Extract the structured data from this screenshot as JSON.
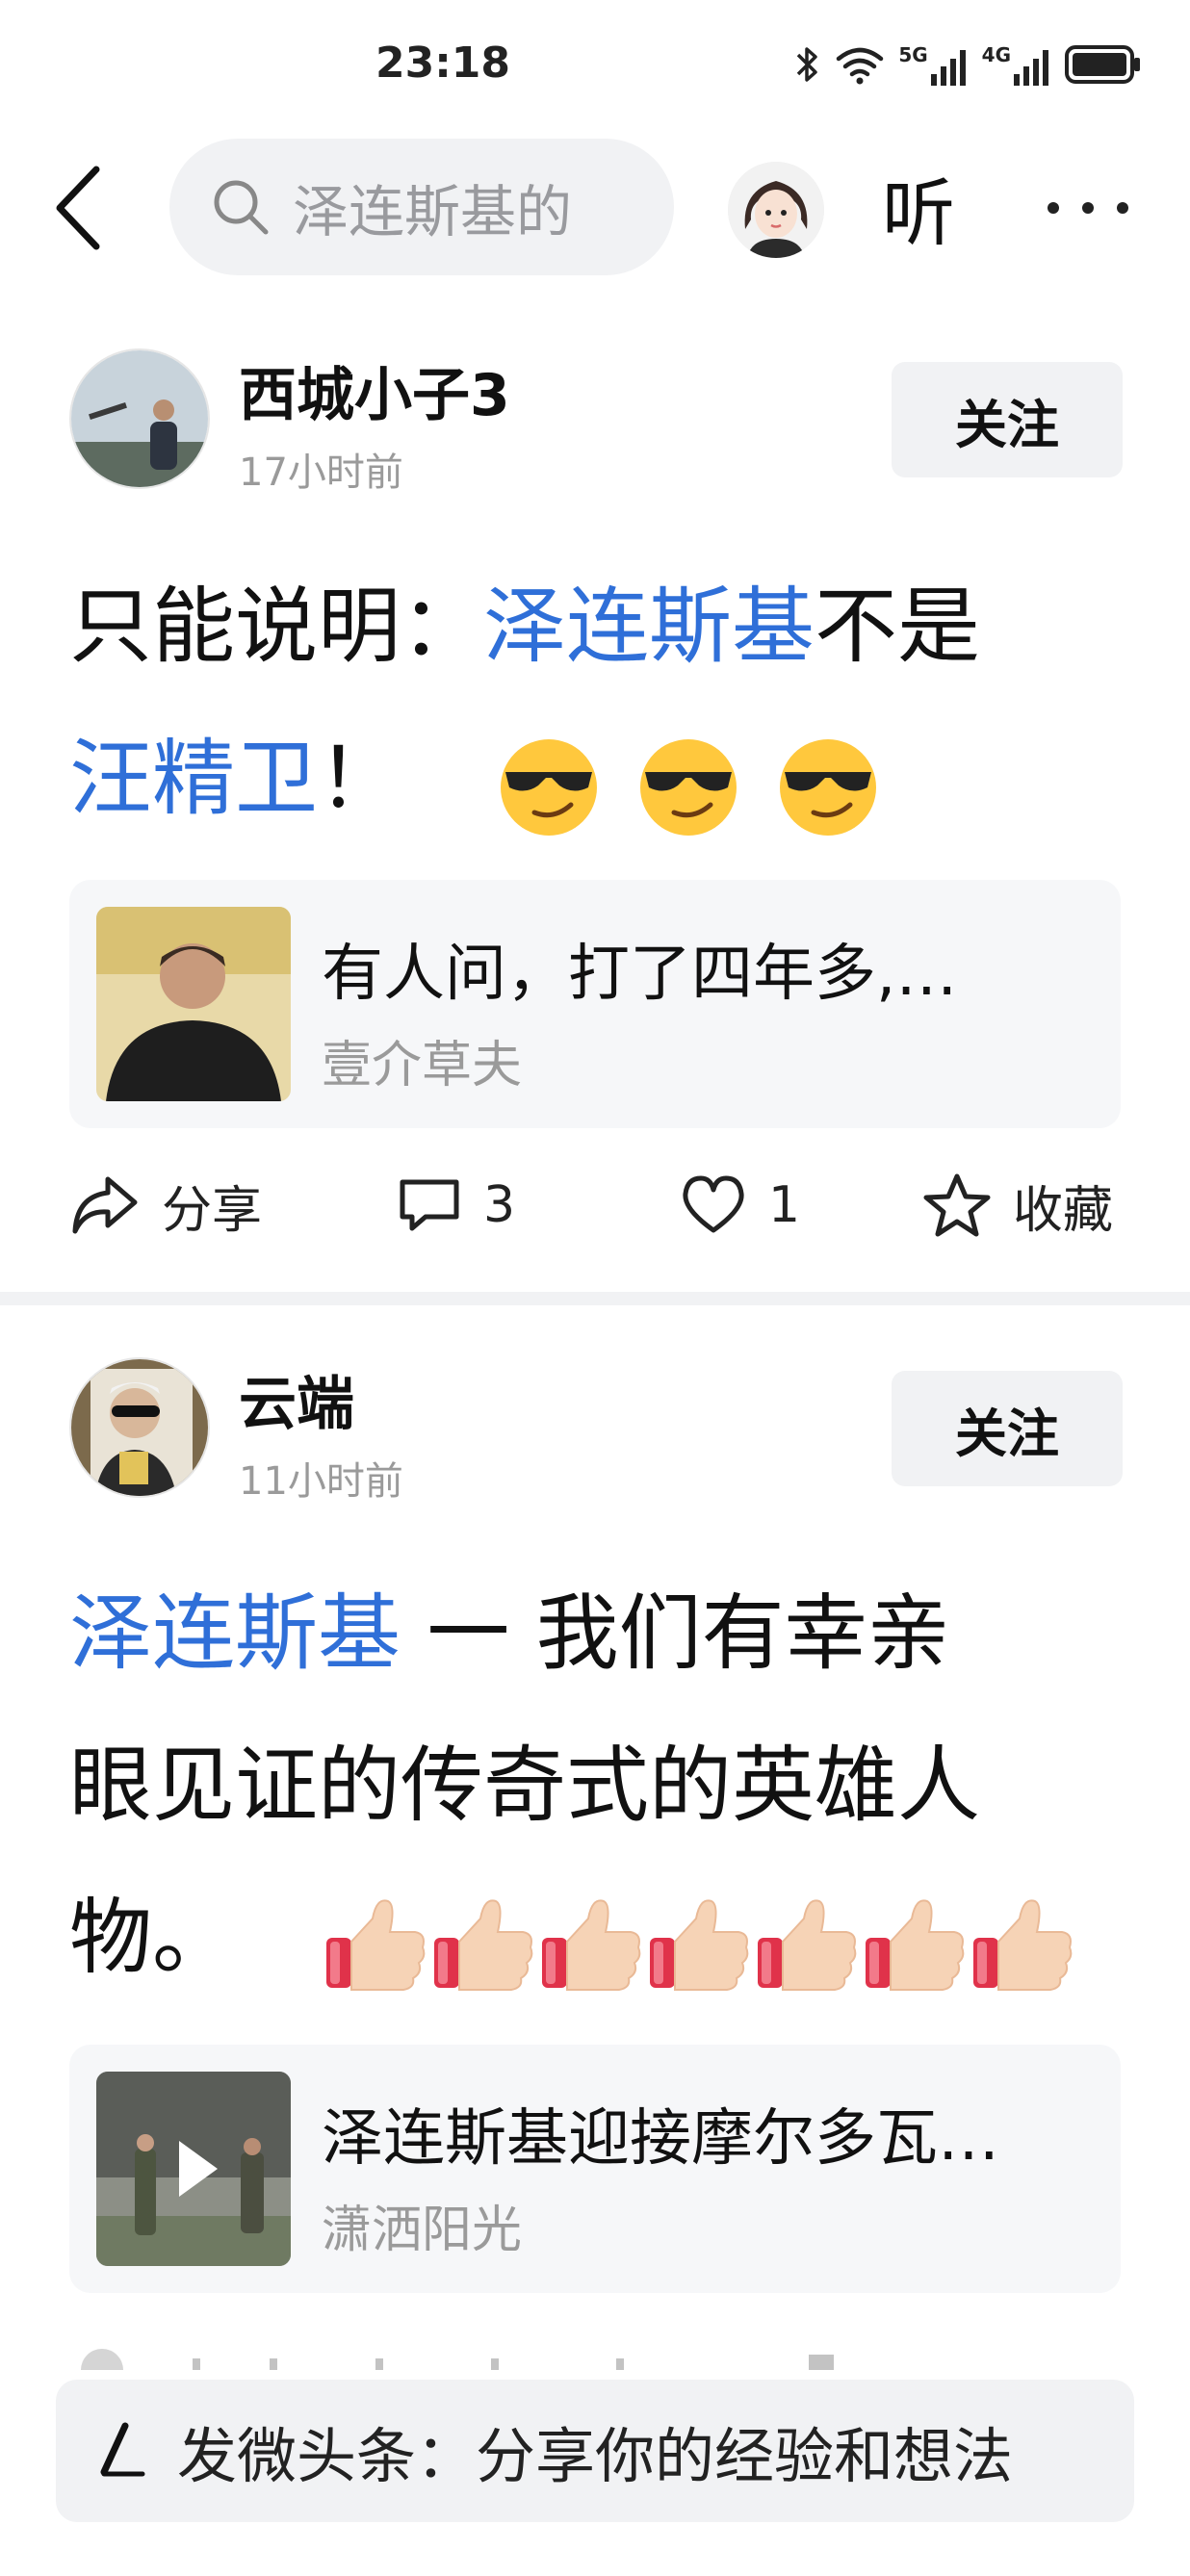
{
  "status_bar": {
    "time": "23:18",
    "network_labels": [
      "5G",
      "4G"
    ],
    "icons": [
      "bluetooth-icon",
      "wifi-icon",
      "signal-5g-icon",
      "signal-4g-icon",
      "battery-icon"
    ]
  },
  "header": {
    "search_query": "泽连斯基的",
    "listen_label": "听"
  },
  "posts": [
    {
      "author": "西城小子3",
      "time": "17小时前",
      "follow_label": "关注",
      "text_parts": {
        "a": "只能说明：",
        "b": "泽连斯基",
        "c": "不是",
        "d": "汪精卫",
        "e": "！"
      },
      "emoji": [
        "sunglasses-smirk-emoji",
        "sunglasses-smirk-emoji",
        "sunglasses-smirk-emoji"
      ],
      "card": {
        "title": "有人问，打了四年多,…",
        "source": "壹介草夫"
      },
      "actions": {
        "share_label": "分享",
        "comment_count": "3",
        "like_count": "1",
        "favorite_label": "收藏"
      }
    },
    {
      "author": "云端",
      "time": "11小时前",
      "follow_label": "关注",
      "text_parts": {
        "a": "泽连斯基",
        "b": " 一 我们有幸亲",
        "c": "眼见证的传奇式的英雄人",
        "d": "物。"
      },
      "emoji": [
        "thumbs-up-emoji",
        "thumbs-up-emoji",
        "thumbs-up-emoji",
        "thumbs-up-emoji",
        "thumbs-up-emoji",
        "thumbs-up-emoji",
        "thumbs-up-emoji"
      ],
      "card": {
        "title": "泽连斯基迎接摩尔多瓦…",
        "source": "潇洒阳光"
      }
    }
  ],
  "composer": {
    "placeholder": "发微头条：分享你的经验和想法"
  },
  "colors": {
    "highlight": "#2f6fd8",
    "muted": "#9a9a9a",
    "chip_bg": "#f1f2f4",
    "card_bg": "#f6f7f9"
  }
}
